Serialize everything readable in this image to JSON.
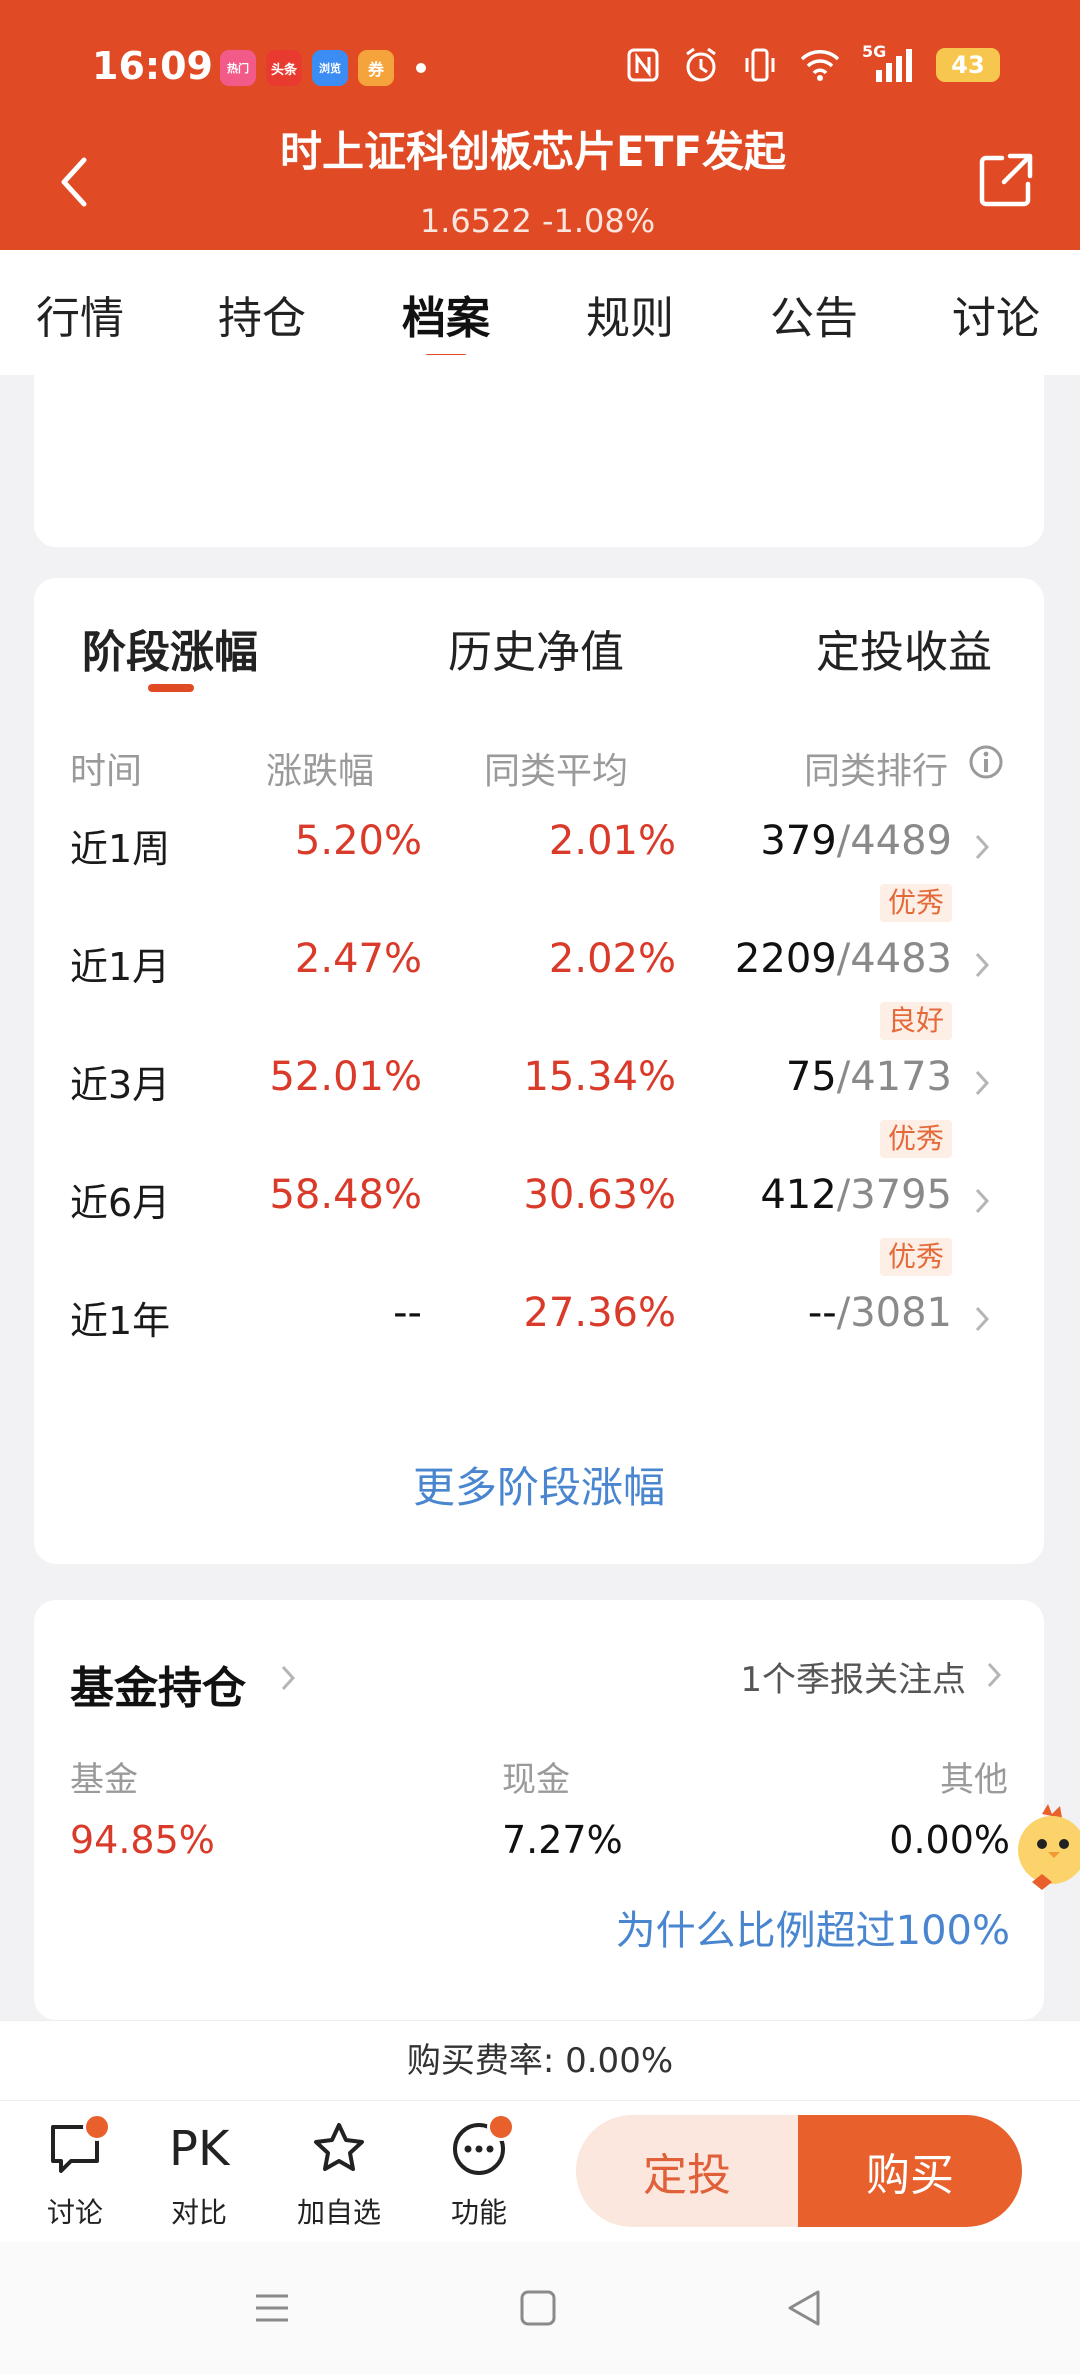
{
  "status": {
    "time": "16:09",
    "apps": [
      "热门",
      "头条",
      "浏览",
      "券"
    ],
    "signal": "5G",
    "battery": "43"
  },
  "header": {
    "title": "时上证科创板芯片ETF发起",
    "subtitle": "1.6522  -1.08%"
  },
  "tabs": [
    "行情",
    "持仓",
    "档案",
    "规则",
    "公告",
    "讨论"
  ],
  "perf": {
    "tabs": [
      "阶段涨幅",
      "历史净值",
      "定投收益"
    ],
    "columns": [
      "时间",
      "涨跌幅",
      "同类平均",
      "同类排行"
    ],
    "rows": [
      {
        "period": "近1周",
        "change": "5.20%",
        "avg": "2.01%",
        "rank": "379",
        "total": "/4489",
        "badge": "优秀"
      },
      {
        "period": "近1月",
        "change": "2.47%",
        "avg": "2.02%",
        "rank": "2209",
        "total": "/4483",
        "badge": "良好"
      },
      {
        "period": "近3月",
        "change": "52.01%",
        "avg": "15.34%",
        "rank": "75",
        "total": "/4173",
        "badge": "优秀"
      },
      {
        "period": "近6月",
        "change": "58.48%",
        "avg": "30.63%",
        "rank": "412",
        "total": "/3795",
        "badge": "优秀"
      },
      {
        "period": "近1年",
        "change": "--",
        "avg": "27.36%",
        "rank": "--",
        "total": "/3081",
        "badge": ""
      }
    ],
    "more": "更多阶段涨幅"
  },
  "holdings": {
    "title": "基金持仓",
    "note": "1个季报关注点",
    "items": [
      {
        "label": "基金",
        "value": "94.85%"
      },
      {
        "label": "现金",
        "value": "7.27%"
      },
      {
        "label": "其他",
        "value": "0.00%"
      }
    ],
    "why": "为什么比例超过100%"
  },
  "fee": "购买费率: 0.00%",
  "bottom": {
    "discuss": "讨论",
    "pk_icon": "PK",
    "compare": "对比",
    "watch": "加自选",
    "func": "功能",
    "dingtou": "定投",
    "buy": "购买"
  },
  "colors": {
    "brand": "#e04a24",
    "up": "#d93a2a",
    "link": "#4a86cf"
  }
}
